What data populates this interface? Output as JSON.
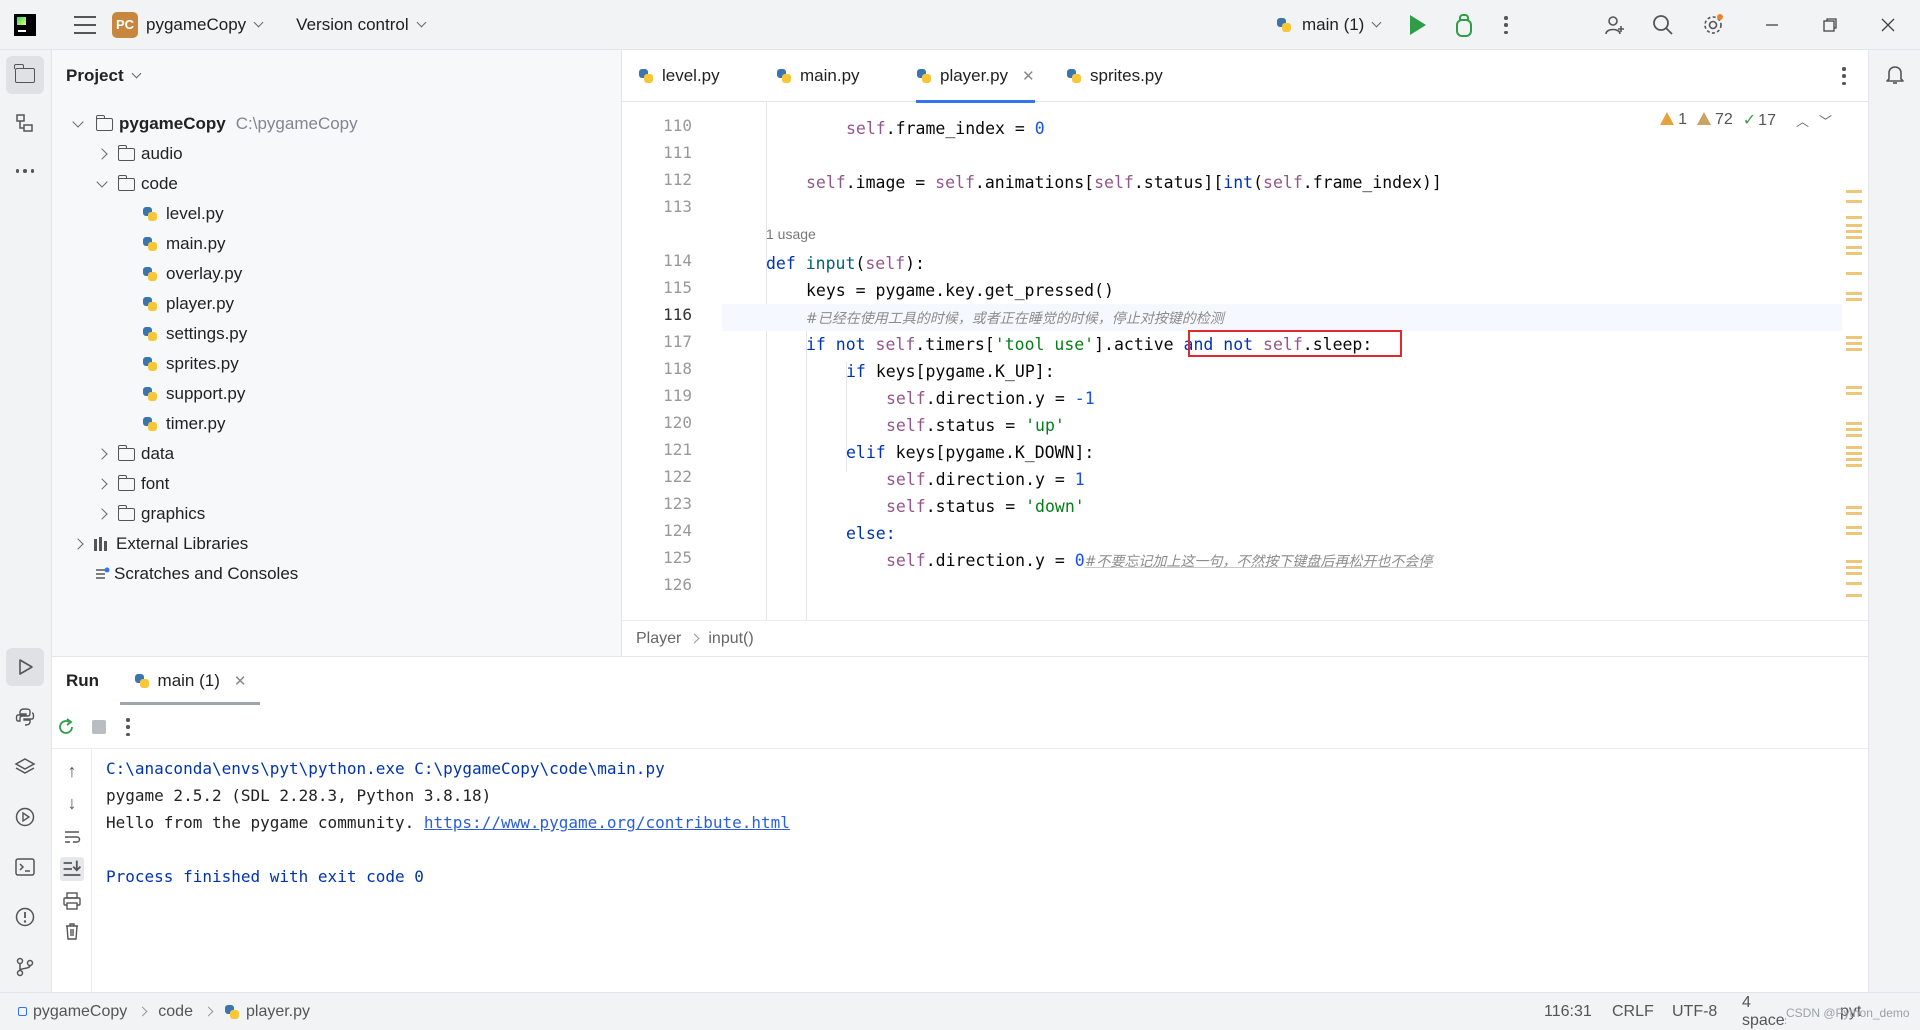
{
  "topbar": {
    "project_badge": "PC",
    "project_name": "pygameCopy",
    "version_control": "Version control",
    "run_config": "main (1)"
  },
  "project_panel": {
    "title": "Project",
    "root": {
      "name": "pygameCopy",
      "path": "C:\\pygameCopy"
    },
    "items": [
      {
        "label": "audio"
      },
      {
        "label": "code"
      },
      {
        "label": "level.py"
      },
      {
        "label": "main.py"
      },
      {
        "label": "overlay.py"
      },
      {
        "label": "player.py"
      },
      {
        "label": "settings.py"
      },
      {
        "label": "sprites.py"
      },
      {
        "label": "support.py"
      },
      {
        "label": "timer.py"
      },
      {
        "label": "data"
      },
      {
        "label": "font"
      },
      {
        "label": "graphics"
      },
      {
        "label": "External Libraries"
      },
      {
        "label": "Scratches and Consoles"
      }
    ]
  },
  "editor": {
    "tabs": [
      {
        "label": "level.py"
      },
      {
        "label": "main.py"
      },
      {
        "label": "player.py",
        "active": true
      },
      {
        "label": "sprites.py"
      }
    ],
    "inspections": {
      "warnings": "1",
      "weak_warnings": "72",
      "ok": "17"
    },
    "line_numbers": [
      "110",
      "111",
      "112",
      "113",
      "114",
      "115",
      "116",
      "117",
      "118",
      "119",
      "120",
      "121",
      "122",
      "123",
      "124",
      "125",
      "126"
    ],
    "usage_hint": "1 usage",
    "code": {
      "l110_a": "self",
      "l110_b": ".frame_index = ",
      "l110_c": "0",
      "l112_a": "self",
      "l112_b": ".image = ",
      "l112_c": "self",
      "l112_d": ".animations[",
      "l112_e": "self",
      "l112_f": ".status][",
      "l112_g": "int",
      "l112_h": "(",
      "l112_i": "self",
      "l112_j": ".frame_index)]",
      "l114_a": "def ",
      "l114_b": "input",
      "l114_c": "(",
      "l114_d": "self",
      "l114_e": "):",
      "l115": "keys = pygame.key.get_pressed()",
      "l116": "#已经在使用工具的时候，或者正在睡觉的时候，停止对按键的检测",
      "l117_a": "if not ",
      "l117_b": "self",
      "l117_c": ".timers[",
      "l117_d": "'tool use'",
      "l117_e": "].active ",
      "l117_f": "and not ",
      "l117_g": "self",
      "l117_h": ".sleep:",
      "l118_a": "if ",
      "l118_b": "keys[pygame.K_UP]:",
      "l119_a": "self",
      "l119_b": ".direction.y = ",
      "l119_c": "-1",
      "l120_a": "self",
      "l120_b": ".status = ",
      "l120_c": "'up'",
      "l121_a": "elif ",
      "l121_b": "keys[pygame.K_DOWN]:",
      "l122_a": "self",
      "l122_b": ".direction.y = ",
      "l122_c": "1",
      "l123_a": "self",
      "l123_b": ".status = ",
      "l123_c": "'down'",
      "l124": "else:",
      "l125_a": "self",
      "l125_b": ".direction.y = ",
      "l125_c": "0",
      "l125_d": "#不要忘记加上这一句，不然按下键盘后再松开也不会停"
    },
    "breadcrumb": [
      "Player",
      "input()"
    ]
  },
  "run_panel": {
    "title": "Run",
    "tab_label": "main (1)",
    "console": {
      "line1": "C:\\anaconda\\envs\\pyt\\python.exe C:\\pygameCopy\\code\\main.py",
      "line2": "pygame 2.5.2 (SDL 2.28.3, Python 3.8.18)",
      "line3_text": "Hello from the pygame community. ",
      "line3_link": "https://www.pygame.org/contribute.html",
      "line5": "Process finished with exit code 0"
    }
  },
  "statusbar": {
    "crumbs": [
      "pygameCopy",
      "code",
      "player.py"
    ],
    "position": "116:31",
    "line_ending": "CRLF",
    "encoding": "UTF-8",
    "indent": "4 spaces",
    "filetype": "pyt",
    "watermark": "CSDN @Python_demo"
  },
  "colors": {
    "accent": "#3574f0",
    "run_green": "#2e9d47",
    "highlight_box": "#e0282e"
  }
}
